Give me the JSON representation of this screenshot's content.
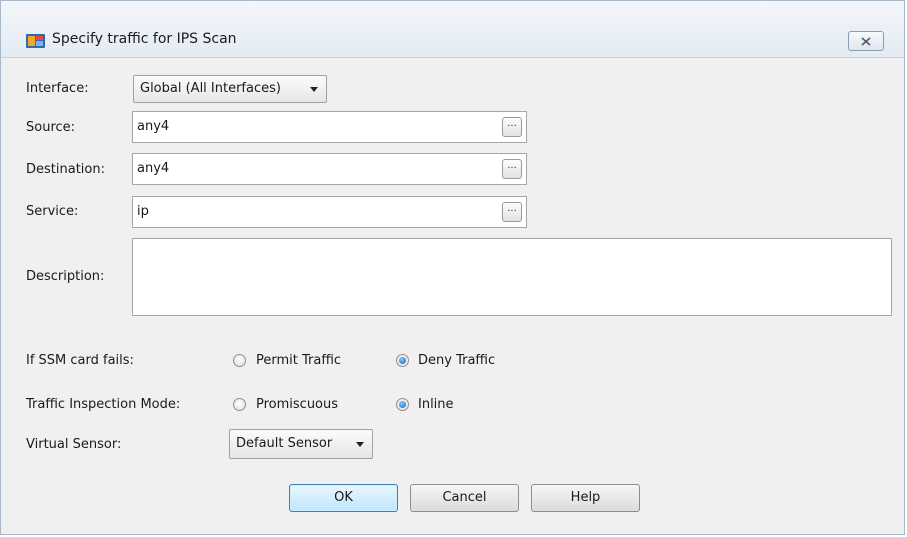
{
  "window": {
    "title": "Specify traffic for IPS Scan",
    "title_icon": "asdm-app-icon",
    "close_icon": "close-x-icon"
  },
  "form": {
    "interface": {
      "label": "Interface:",
      "value": "Global (All Interfaces)"
    },
    "source": {
      "label": "Source:",
      "value": "any4",
      "browse": "..."
    },
    "destination": {
      "label": "Destination:",
      "value": "any4",
      "browse": "..."
    },
    "service": {
      "label": "Service:",
      "value": "ip",
      "browse": "..."
    },
    "description": {
      "label": "Description:",
      "value": ""
    }
  },
  "ssm_fail": {
    "label": "If SSM card fails:",
    "options": [
      {
        "label": "Permit Traffic",
        "checked": false
      },
      {
        "label": "Deny Traffic",
        "checked": true
      }
    ]
  },
  "inspection_mode": {
    "label": "Traffic Inspection Mode:",
    "options": [
      {
        "label": "Promiscuous",
        "checked": false
      },
      {
        "label": "Inline",
        "checked": true
      }
    ]
  },
  "virtual_sensor": {
    "label": "Virtual Sensor:",
    "value": "Default Sensor"
  },
  "buttons": {
    "ok": "OK",
    "cancel": "Cancel",
    "help": "Help"
  },
  "colors": {
    "default_button_border": "#3c7fb1",
    "radio_fill": "#1a5fb4"
  }
}
